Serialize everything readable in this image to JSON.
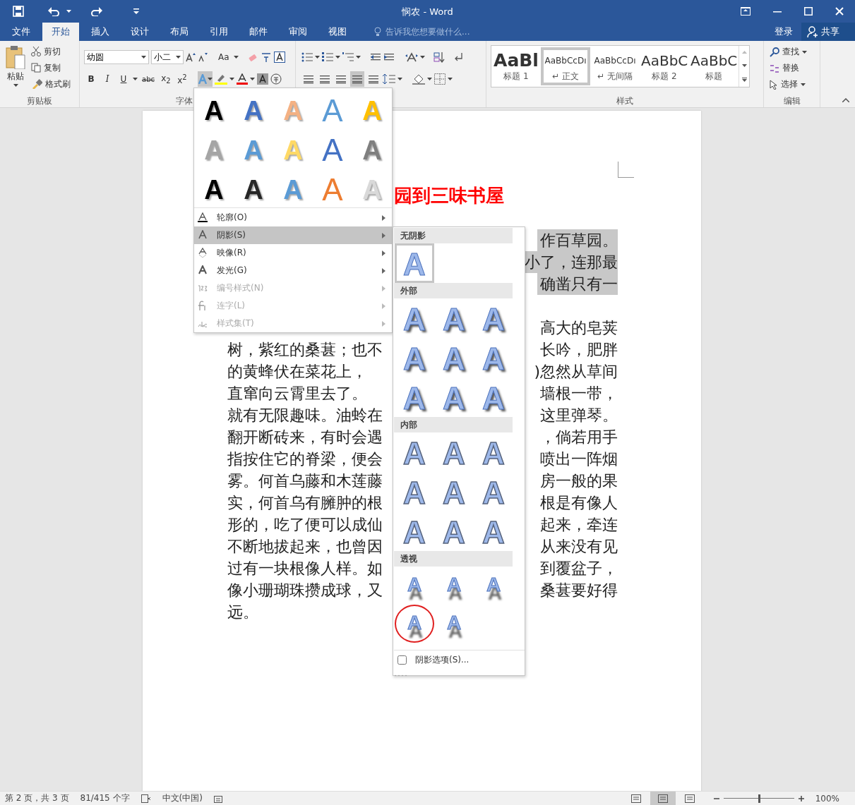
{
  "window": {
    "title": "悯农 - Word"
  },
  "ribbon_tabs": [
    {
      "label": "文件",
      "selected": false
    },
    {
      "label": "开始",
      "selected": true
    },
    {
      "label": "插入",
      "selected": false
    },
    {
      "label": "设计",
      "selected": false
    },
    {
      "label": "布局",
      "selected": false
    },
    {
      "label": "引用",
      "selected": false
    },
    {
      "label": "邮件",
      "selected": false
    },
    {
      "label": "审阅",
      "selected": false
    },
    {
      "label": "视图",
      "selected": false
    }
  ],
  "tell_me": {
    "placeholder": "告诉我您想要做什么..."
  },
  "account": {
    "sign_in": "登录",
    "share": "共享"
  },
  "clipboard": {
    "paste": "粘贴",
    "cut": "剪切",
    "copy": "复制",
    "format_painter": "格式刷",
    "label": "剪贴板"
  },
  "font": {
    "name": "幼圆",
    "size": "小二",
    "case_button": "Aa",
    "format_buttons": [
      "B",
      "I",
      "U",
      "abc",
      "x$_{2}$",
      "x$^{2}$"
    ],
    "text_effects_open": true,
    "label": "字体"
  },
  "paragraph": {
    "alignments": [
      {
        "selected": false
      },
      {
        "selected": false
      },
      {
        "selected": false
      },
      {
        "selected": true
      },
      {
        "selected": false
      }
    ]
  },
  "styles": {
    "label": "样式",
    "items": [
      {
        "preview": "AaBl",
        "name": "标题 1",
        "kind": "heading",
        "selected": false
      },
      {
        "preview": "AaBbCcDı",
        "name": "↵ 正文",
        "kind": "body",
        "selected": true
      },
      {
        "preview": "AaBbCcDı",
        "name": "↵ 无间隔",
        "kind": "body",
        "selected": false
      },
      {
        "preview": "AaBbC",
        "name": "标题 2",
        "kind": "subheading",
        "selected": false
      },
      {
        "preview": "AaBbC",
        "name": "标题",
        "kind": "subheading",
        "selected": false
      }
    ]
  },
  "editing": {
    "find": "查找",
    "replace": "替换",
    "select": "选择",
    "label": "编辑"
  },
  "document": {
    "title": "园到三味书屋",
    "paragraphs": [
      {
        "highlighted": true,
        "lines": [
          {
            "right": "作百草园。"
          },
          {
            "right": "小了，连那最"
          },
          {
            "right": "确凿只有一"
          }
        ]
      },
      {
        "highlighted": false,
        "lines": [
          {
            "right": "高大的皂荚"
          },
          {
            "left": "树，紫红的桑葚；也不",
            "right": "长吟，肥胖"
          },
          {
            "left": "的黄蜂伏在菜花上，",
            "right": ")忽然从草间"
          },
          {
            "left": "直窜向云霄里去了。",
            "right": "墙根一带，"
          },
          {
            "left": "就有无限趣味。油蛉在",
            "right": "这里弹琴。"
          },
          {
            "left": "翻开断砖来，有时会遇",
            "right": "，倘若用手"
          },
          {
            "left": "指按住它的脊梁，便会",
            "right": "喷出一阵烟"
          },
          {
            "left": "雾。何首乌藤和木莲藤",
            "right": "房一般的果"
          },
          {
            "left": "实，何首乌有臃肿的根",
            "right": "根是有像人"
          },
          {
            "left": "形的，吃了便可以成仙",
            "right": "起来，牵连"
          },
          {
            "left": "不断地拔起来，也曾因",
            "right": "从来没有见"
          },
          {
            "left": "过有一块根像人样。如",
            "right": "到覆盆子，"
          },
          {
            "left": "像小珊瑚珠攒成球，又",
            "right": "桑葚要好得"
          },
          {
            "left": "远。"
          }
        ]
      }
    ]
  },
  "text_effects_menu": {
    "gallery": [
      {
        "text": "A",
        "kind": "solid",
        "color": "#000000"
      },
      {
        "text": "A",
        "kind": "solid",
        "color": "#4472c4"
      },
      {
        "text": "A",
        "kind": "solid",
        "color": "#f4b183"
      },
      {
        "text": "A",
        "kind": "outline",
        "color": "#5b9bd5"
      },
      {
        "text": "A",
        "kind": "solid",
        "color": "#ffc000"
      },
      {
        "text": "A",
        "kind": "solid",
        "color": "#a5a5a5"
      },
      {
        "text": "A",
        "kind": "solid",
        "color": "#5b9bd5"
      },
      {
        "text": "A",
        "kind": "solid",
        "color": "#ffd966"
      },
      {
        "text": "A",
        "kind": "outline",
        "color": "#4472c4"
      },
      {
        "text": "A",
        "kind": "solid",
        "color": "#7f7f7f"
      },
      {
        "text": "A",
        "kind": "solid",
        "color": "#000000"
      },
      {
        "text": "A",
        "kind": "solid",
        "color": "#262626"
      },
      {
        "text": "A",
        "kind": "solid",
        "color": "#5b9bd5"
      },
      {
        "text": "A",
        "kind": "outline",
        "color": "#ed7d31"
      },
      {
        "text": "A",
        "kind": "solid",
        "color": "#d9d9d9"
      }
    ],
    "items": [
      {
        "label": "轮廓(O)",
        "kind": "outline",
        "selected": false,
        "disabled": false
      },
      {
        "label": "阴影(S)",
        "kind": "shadow",
        "selected": true,
        "disabled": false
      },
      {
        "label": "映像(R)",
        "kind": "reflection",
        "selected": false,
        "disabled": false
      },
      {
        "label": "发光(G)",
        "kind": "glow",
        "selected": false,
        "disabled": false
      },
      {
        "label": "编号样式(N)",
        "kind": "number",
        "selected": false,
        "disabled": true
      },
      {
        "label": "连字(L)",
        "kind": "ligature",
        "selected": false,
        "disabled": true
      },
      {
        "label": "样式集(T)",
        "kind": "stylistic",
        "selected": false,
        "disabled": true
      }
    ]
  },
  "shadow_menu": {
    "groups": [
      {
        "heading": "无阴影",
        "kind": "none",
        "items": [
          {
            "text": "A",
            "selected": true
          }
        ]
      },
      {
        "heading": "外部",
        "kind": "outer",
        "items": [
          {
            "text": "A",
            "selected": false
          },
          {
            "text": "A",
            "selected": false
          },
          {
            "text": "A",
            "selected": false
          },
          {
            "text": "A",
            "selected": false
          },
          {
            "text": "A",
            "selected": false
          },
          {
            "text": "A",
            "selected": false
          },
          {
            "text": "A",
            "selected": false
          },
          {
            "text": "A",
            "selected": false
          },
          {
            "text": "A",
            "selected": false
          }
        ]
      },
      {
        "heading": "内部",
        "kind": "inner",
        "items": [
          {
            "text": "A",
            "selected": false
          },
          {
            "text": "A",
            "selected": false
          },
          {
            "text": "A",
            "selected": false
          },
          {
            "text": "A",
            "selected": false
          },
          {
            "text": "A",
            "selected": false
          },
          {
            "text": "A",
            "selected": false
          },
          {
            "text": "A",
            "selected": false
          },
          {
            "text": "A",
            "selected": false
          },
          {
            "text": "A",
            "selected": false
          }
        ]
      },
      {
        "heading": "透视",
        "kind": "perspective",
        "items": [
          {
            "text": "A",
            "selected": false,
            "circled": false
          },
          {
            "text": "A",
            "selected": false,
            "circled": false
          },
          {
            "text": "A",
            "selected": false,
            "circled": false
          },
          {
            "text": "A",
            "selected": false,
            "circled": true
          },
          {
            "text": "A",
            "selected": false,
            "circled": false
          }
        ]
      }
    ],
    "options": {
      "label": "阴影选项(S)...",
      "checked": false
    }
  },
  "status_bar": {
    "page": "第 2 页，共 3 页",
    "words": "81/415 个字",
    "language": "中文(中国)",
    "views": [
      {
        "selected": false
      },
      {
        "selected": true
      },
      {
        "selected": false
      }
    ],
    "zoom": {
      "level": 0.5,
      "reading": "100%"
    }
  }
}
